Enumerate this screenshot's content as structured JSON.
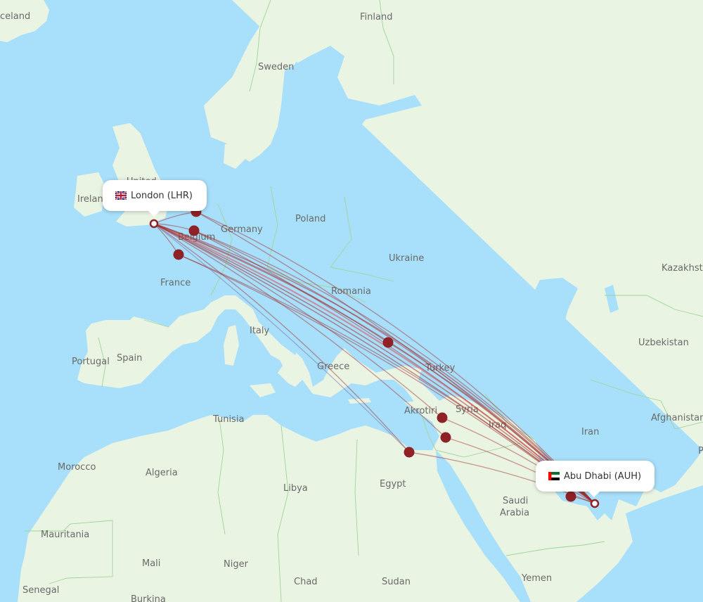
{
  "map": {
    "colors": {
      "water": "#a8dffa",
      "land": "#eaf4e3",
      "land_shade": "#e2eed9",
      "border": "#9fd49a",
      "route": "#a02a2a",
      "route_highlight": "#e0484a",
      "airport_dot": "#8e2226",
      "label": "#6a6a6a"
    },
    "country_labels": [
      {
        "name": "Iceland",
        "text": "celand"
      },
      {
        "name": "Finland",
        "text": "Finland"
      },
      {
        "name": "Sweden",
        "text": "Sweden"
      },
      {
        "name": "Ireland",
        "text": "Irelan"
      },
      {
        "name": "United Kingdom",
        "text": "United"
      },
      {
        "name": "Poland",
        "text": "Poland"
      },
      {
        "name": "Germany",
        "text": "Germany"
      },
      {
        "name": "Belgium",
        "text": "Belgium"
      },
      {
        "name": "Ukraine",
        "text": "Ukraine"
      },
      {
        "name": "France",
        "text": "France"
      },
      {
        "name": "Romania",
        "text": "Romania"
      },
      {
        "name": "Kazakhstan",
        "text": "Kazakhst"
      },
      {
        "name": "Italy",
        "text": "Italy"
      },
      {
        "name": "Uzbekistan",
        "text": "Uzbekistan"
      },
      {
        "name": "Portugal",
        "text": "Portugal"
      },
      {
        "name": "Spain",
        "text": "Spain"
      },
      {
        "name": "Greece",
        "text": "Greece"
      },
      {
        "name": "Turkey",
        "text": "Turkey"
      },
      {
        "name": "Syria",
        "text": "Syria"
      },
      {
        "name": "Akrotiri",
        "text": "Akrotiri"
      },
      {
        "name": "Tunisia",
        "text": "Tunisia"
      },
      {
        "name": "Iraq",
        "text": "Iraq"
      },
      {
        "name": "Iran",
        "text": "Iran"
      },
      {
        "name": "Afghanistan",
        "text": "Afghanistan"
      },
      {
        "name": "Pakistan",
        "text": "P"
      },
      {
        "name": "Morocco",
        "text": "Morocco"
      },
      {
        "name": "Algeria",
        "text": "Algeria"
      },
      {
        "name": "Libya",
        "text": "Libya"
      },
      {
        "name": "Egypt",
        "text": "Egypt"
      },
      {
        "name": "Saudi Arabia line 1",
        "text": "Saudi"
      },
      {
        "name": "Saudi Arabia line 2",
        "text": "Arabia"
      },
      {
        "name": "Mauritania",
        "text": "Mauritania"
      },
      {
        "name": "Mali",
        "text": "Mali"
      },
      {
        "name": "Niger",
        "text": "Niger"
      },
      {
        "name": "Chad",
        "text": "Chad"
      },
      {
        "name": "Sudan",
        "text": "Sudan"
      },
      {
        "name": "Yemen",
        "text": "Yemen"
      },
      {
        "name": "Senegal",
        "text": "Senegal"
      },
      {
        "name": "Burkina Faso",
        "text": "Burkina"
      }
    ],
    "origin": {
      "label": "London (LHR)",
      "city": "London",
      "code": "LHR",
      "flag": "united-kingdom"
    },
    "destination": {
      "label": "Abu Dhabi (AUH)",
      "city": "Abu Dhabi",
      "code": "AUH",
      "flag": "united-arab-emirates"
    },
    "stopovers": [
      {
        "name": "Amsterdam area"
      },
      {
        "name": "Brussels area"
      },
      {
        "name": "Paris area"
      },
      {
        "name": "Istanbul area"
      },
      {
        "name": "Beirut area"
      },
      {
        "name": "Amman area"
      },
      {
        "name": "Cairo area"
      },
      {
        "name": "Gulf area"
      }
    ],
    "route_count": 20
  }
}
